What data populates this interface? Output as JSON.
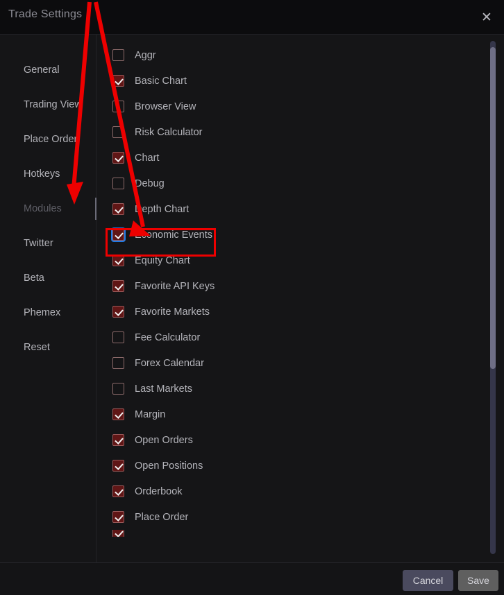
{
  "window": {
    "title": "Trade Settings",
    "close_icon": "close-icon"
  },
  "sidebar": {
    "items": [
      {
        "label": "General",
        "state": "normal"
      },
      {
        "label": "Trading View",
        "state": "normal"
      },
      {
        "label": "Place Order",
        "state": "normal"
      },
      {
        "label": "Hotkeys",
        "state": "normal"
      },
      {
        "label": "Modules",
        "state": "active"
      },
      {
        "label": "Twitter",
        "state": "normal"
      },
      {
        "label": "Beta",
        "state": "normal"
      },
      {
        "label": "Phemex",
        "state": "normal"
      },
      {
        "label": "Reset",
        "state": "normal"
      }
    ]
  },
  "modules": {
    "items": [
      {
        "label": "Aggr",
        "checked": false,
        "focused": false
      },
      {
        "label": "Basic Chart",
        "checked": true,
        "focused": false
      },
      {
        "label": "Browser View",
        "checked": false,
        "focused": false
      },
      {
        "label": "Risk Calculator",
        "checked": false,
        "focused": false
      },
      {
        "label": "Chart",
        "checked": true,
        "focused": false
      },
      {
        "label": "Debug",
        "checked": false,
        "focused": false
      },
      {
        "label": "Depth Chart",
        "checked": true,
        "focused": false
      },
      {
        "label": "Economic Events",
        "checked": true,
        "focused": true
      },
      {
        "label": "Equity Chart",
        "checked": true,
        "focused": false
      },
      {
        "label": "Favorite API Keys",
        "checked": true,
        "focused": false
      },
      {
        "label": "Favorite Markets",
        "checked": true,
        "focused": false
      },
      {
        "label": "Fee Calculator",
        "checked": false,
        "focused": false
      },
      {
        "label": "Forex Calendar",
        "checked": false,
        "focused": false
      },
      {
        "label": "Last Markets",
        "checked": false,
        "focused": false
      },
      {
        "label": "Margin",
        "checked": true,
        "focused": false
      },
      {
        "label": "Open Orders",
        "checked": true,
        "focused": false
      },
      {
        "label": "Open Positions",
        "checked": true,
        "focused": false
      },
      {
        "label": "Orderbook",
        "checked": true,
        "focused": false
      },
      {
        "label": "Place Order",
        "checked": true,
        "focused": false
      }
    ]
  },
  "footer": {
    "cancel_label": "Cancel",
    "save_label": "Save"
  },
  "colors": {
    "accent_checked": "#601616",
    "focus_ring": "#1e7ae6",
    "annotation": "#ee0000",
    "cancel_bg": "#4a4a5e",
    "save_bg": "#5f5f5f",
    "scrollbar_thumb": "#6f6f86"
  }
}
